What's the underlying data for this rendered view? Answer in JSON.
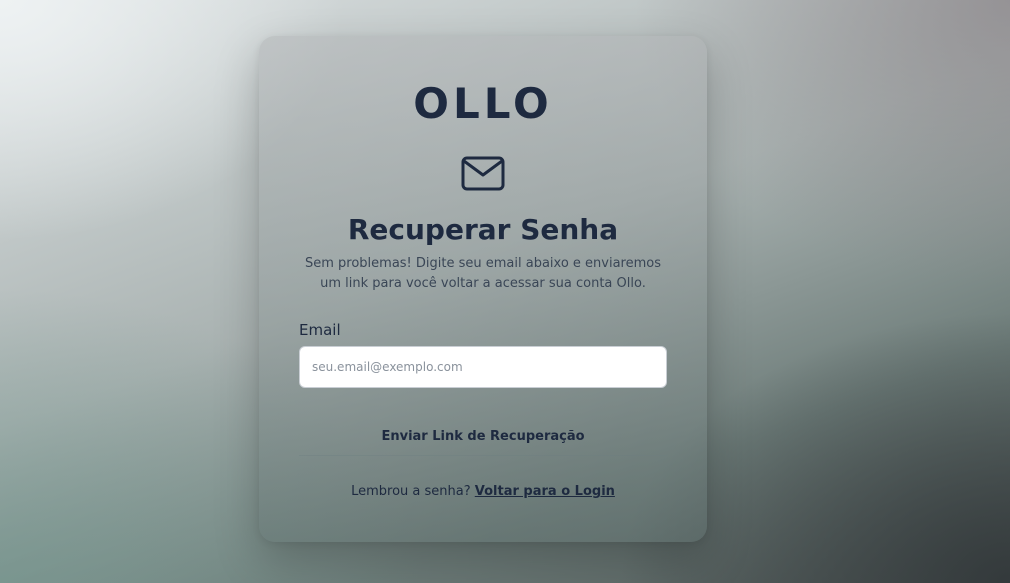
{
  "brand": {
    "logo_text": "OLLO",
    "primary_color": "#1e2a40"
  },
  "header": {
    "icon": "envelope-icon",
    "title": "Recuperar Senha",
    "subtitle": "Sem problemas! Digite seu email abaixo e enviaremos um link para você voltar a acessar sua conta Ollo."
  },
  "form": {
    "email_label": "Email",
    "email_value": "",
    "email_placeholder": "seu.email@exemplo.com",
    "submit_label": "Enviar Link de Recuperação"
  },
  "footer": {
    "prompt": "Lembrou a senha?",
    "link_label": "Voltar para o Login"
  }
}
